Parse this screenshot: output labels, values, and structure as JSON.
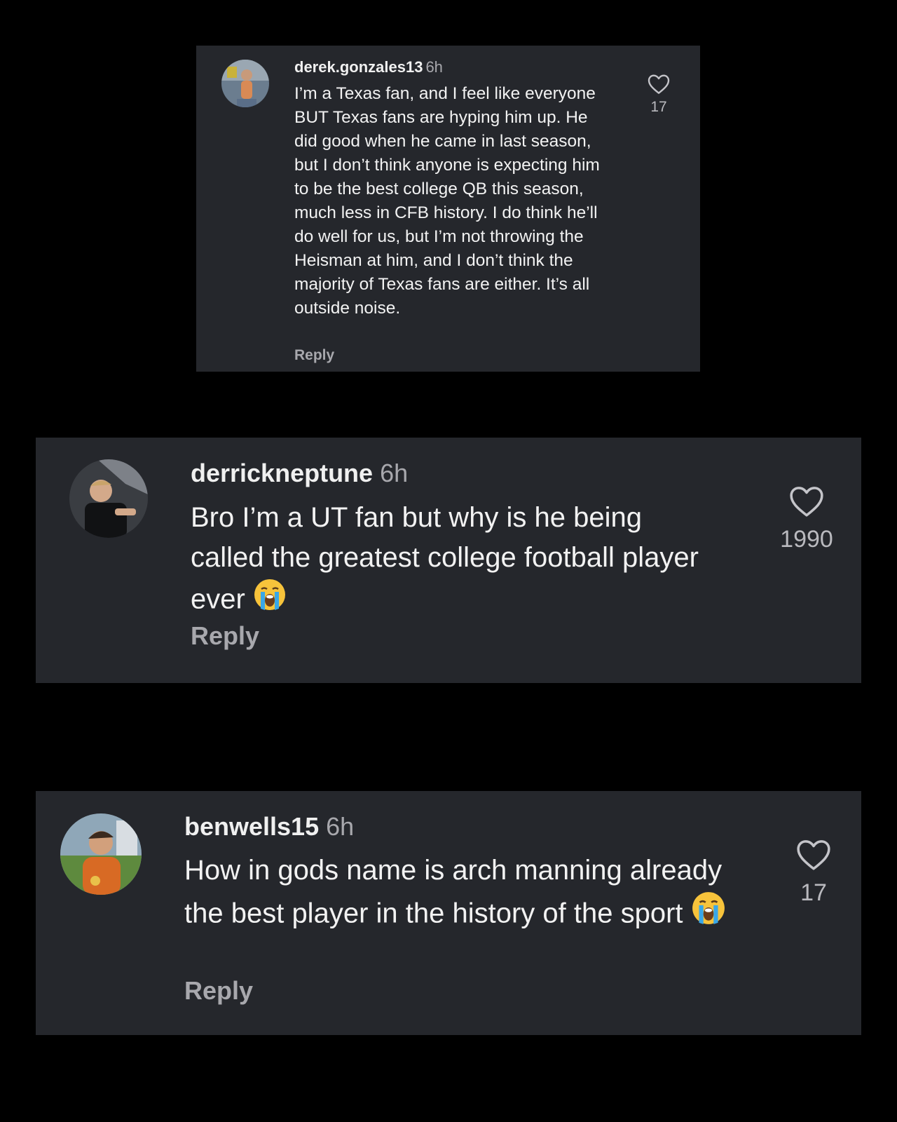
{
  "comments": [
    {
      "username": "derek.gonzales13",
      "time": "6h",
      "text": "I’m a Texas fan, and I feel like everyone BUT Texas fans are hyping him up. He did good when he came in last season, but I don’t think anyone is expecting him to be the best college QB this season, much less in CFB history. I do think he’ll do well for us, but I’m not throwing the Heisman at him, and I don’t think the majority of Texas fans are either. It’s all outside noise.",
      "reply_label": "Reply",
      "likes": "17",
      "avatar": "photo-avatar",
      "like_icon": "heart-outline-icon"
    },
    {
      "username": "derrickneptune",
      "time": "6h",
      "text": "Bro I’m a UT fan but why is he being called the greatest college football player ever",
      "emoji": "loudly-crying-face-emoji",
      "reply_label": "Reply",
      "likes": "1990",
      "avatar": "photo-avatar",
      "like_icon": "heart-outline-icon"
    },
    {
      "username": "benwells15",
      "time": "6h",
      "text": "How in gods name is arch manning already the best player in the history of the sport",
      "emoji": "loudly-crying-face-emoji",
      "reply_label": "Reply",
      "likes": "17",
      "avatar": "photo-avatar",
      "like_icon": "heart-outline-icon"
    }
  ],
  "colors": {
    "page_background": "#000000",
    "card_background": "#25272c",
    "primary_text": "#f2f2f2",
    "secondary_text": "#a8a8ad"
  }
}
